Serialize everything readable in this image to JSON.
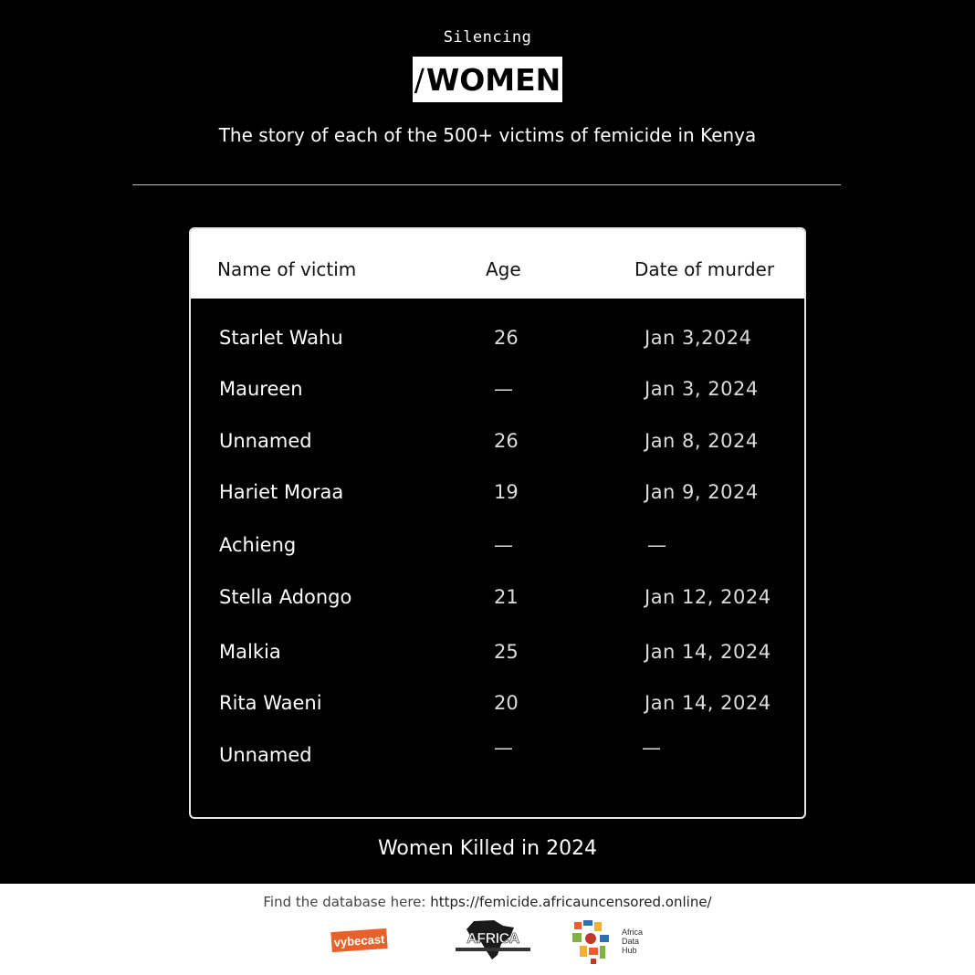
{
  "header": {
    "kicker": "Silencing",
    "logo_slash": "/",
    "logo_word": "WOMEN",
    "subtitle": "The story of each of the 500+ victims of femicide in Kenya"
  },
  "table": {
    "columns": [
      "Name of victim",
      "Age",
      "Date of murder"
    ],
    "rows": [
      {
        "name": "Starlet Wahu",
        "age": "26",
        "date": "Jan 3,2024"
      },
      {
        "name": "Maureen",
        "age": "—",
        "date": "Jan 3, 2024"
      },
      {
        "name": "Unnamed",
        "age": "26",
        "date": "Jan 8, 2024"
      },
      {
        "name": "Hariet Moraa",
        "age": "19",
        "date": "Jan 9, 2024"
      },
      {
        "name": "Achieng",
        "age": "—",
        "date": "—"
      },
      {
        "name": "Stella Adongo",
        "age": "21",
        "date": "Jan 12, 2024"
      },
      {
        "name": "Malkia",
        "age": "25",
        "date": "Jan 14, 2024"
      },
      {
        "name": "Rita Waeni",
        "age": "20",
        "date": "Jan 14, 2024"
      },
      {
        "name": "Unnamed",
        "age": "—",
        "date": "—"
      }
    ]
  },
  "footer": {
    "title": "Women Killed in 2024",
    "note_prefix": "Find the database here: ",
    "note_url": "https://femicide.africauncensored.online/",
    "partners": [
      {
        "name": "vybecast",
        "color": "#e8612a"
      },
      {
        "name": "AFRICA"
      },
      {
        "name": "Africa Data Hub",
        "lines": [
          "Africa",
          "Data",
          "Hub"
        ]
      }
    ]
  }
}
